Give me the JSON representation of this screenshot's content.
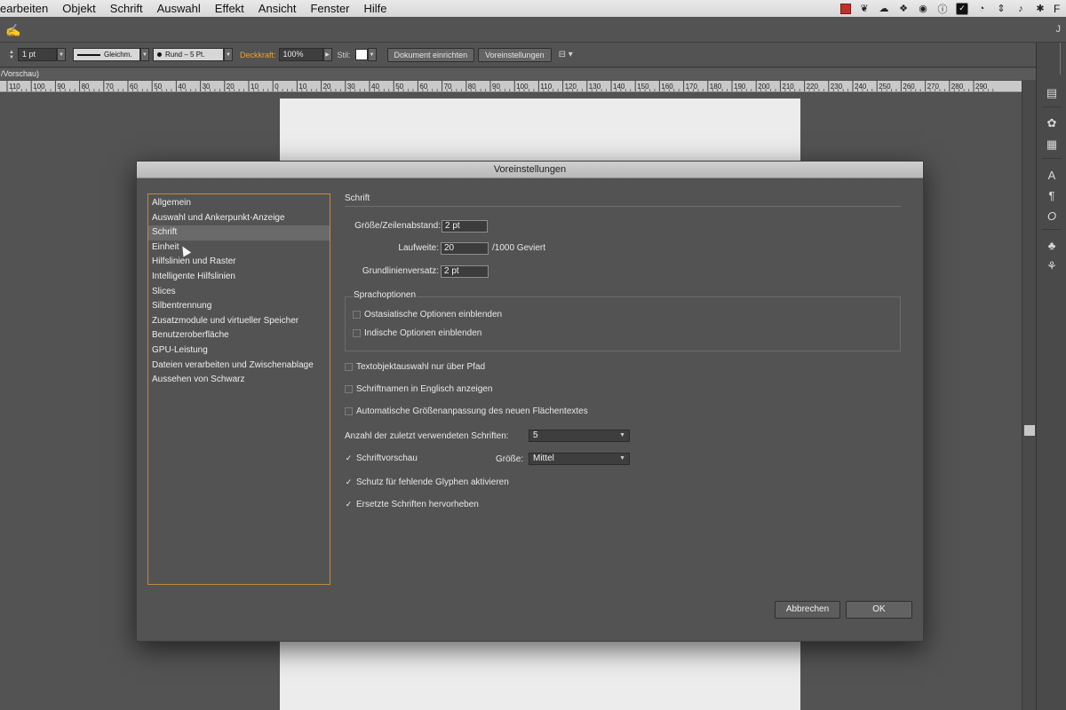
{
  "menubar": {
    "items": [
      "earbeiten",
      "Objekt",
      "Schrift",
      "Auswahl",
      "Effekt",
      "Ansicht",
      "Fenster",
      "Hilfe"
    ],
    "trailing_text": "F"
  },
  "appbar": {
    "app_icon": "illustrator-brush-icon",
    "workspace_label": "J"
  },
  "controlbar": {
    "stroke_weight": "1 pt",
    "profile": "Gleichm.",
    "brush": "Rund – 5 Pt.",
    "opacity_label": "Deckkraft:",
    "opacity_value": "100%",
    "style_label": "Stil:",
    "btn_document_setup": "Dokument einrichten",
    "btn_preferences": "Voreinstellungen",
    "accent": "#f0a030"
  },
  "document": {
    "tab_label": "/Vorschau)"
  },
  "ruler": {
    "labels": [
      "110",
      "100",
      "90",
      "80",
      "70",
      "60",
      "50",
      "40",
      "30",
      "20",
      "10",
      "0",
      "10",
      "20",
      "30",
      "40",
      "50",
      "60",
      "70",
      "80",
      "90",
      "100",
      "110",
      "120",
      "130",
      "140",
      "150",
      "160",
      "170",
      "180",
      "190",
      "200",
      "210",
      "220",
      "230",
      "240",
      "250",
      "260",
      "270",
      "280",
      "290"
    ]
  },
  "dialog": {
    "title": "Voreinstellungen",
    "categories": [
      "Allgemein",
      "Auswahl und Ankerpunkt-Anzeige",
      "Schrift",
      "Einheit",
      "Hilfslinien und Raster",
      "Intelligente Hilfslinien",
      "Slices",
      "Silbentrennung",
      "Zusatzmodule und virtueller Speicher",
      "Benutzeroberfläche",
      "GPU-Leistung",
      "Dateien verarbeiten und Zwischenablage",
      "Aussehen von Schwarz"
    ],
    "selected_category": "Schrift",
    "section_title": "Schrift",
    "size_leading_label": "Größe/Zeilenabstand:",
    "size_leading_value": "2 pt",
    "tracking_label": "Laufweite:",
    "tracking_value": "20",
    "tracking_unit": "/1000 Geviert",
    "baseline_label": "Grundlinienversatz:",
    "baseline_value": "2 pt",
    "language_group_title": "Sprachoptionen",
    "cb_east_asian": "Ostasiatische Optionen einblenden",
    "cb_indic": "Indische Optionen einblenden",
    "cb_path_select": "Textobjektauswahl nur über Pfad",
    "cb_english_names": "Schriftnamen in Englisch anzeigen",
    "cb_auto_size": "Automatische Größenanpassung des neuen Flächentextes",
    "recent_fonts_label": "Anzahl der zuletzt verwendeten Schriften:",
    "recent_fonts_value": "5",
    "cb_font_preview": "Schriftvorschau",
    "preview_size_label": "Größe:",
    "preview_size_value": "Mittel",
    "cb_glyph_protection": "Schutz für fehlende Glyphen aktivieren",
    "cb_highlight_substituted": "Ersetzte Schriften hervorheben",
    "checked": {
      "east_asian": false,
      "indic": false,
      "path_select": false,
      "english_names": false,
      "auto_size": false,
      "font_preview": true,
      "glyph_protection": true,
      "highlight_substituted": true
    },
    "btn_cancel": "Abbrechen",
    "btn_ok": "OK"
  },
  "panel_icons": [
    "libraries-icon",
    "color-palette-icon",
    "swatches-grid-icon",
    "character-icon",
    "paragraph-icon",
    "opentype-icon",
    "symbols-club-icon",
    "brushes-icon"
  ]
}
